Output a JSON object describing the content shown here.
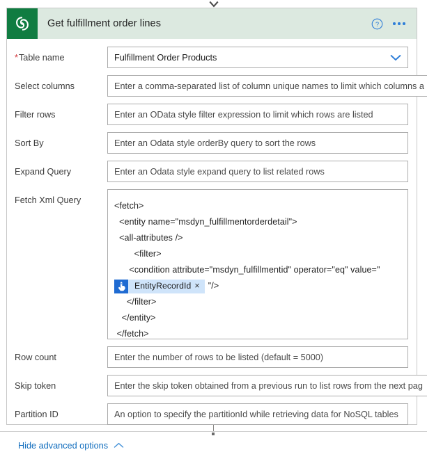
{
  "connector": {
    "arrow_icon": "arrow-down-icon",
    "stub_icon": "connector-stub"
  },
  "header": {
    "app_icon": "dataverse-icon",
    "title": "Get fulfillment order lines",
    "help_icon": "help-circle-icon",
    "more_icon": "more-horizontal-icon",
    "bg_color": "#dce9e0",
    "icon_bg_color": "#107c41",
    "accent_color": "#2f7ed8"
  },
  "fields": [
    {
      "label": "Table name",
      "required": true,
      "type": "dropdown",
      "value": "Fulfillment Order Products",
      "placeholder": "",
      "chevron_icon": "chevron-down-icon"
    },
    {
      "label": "Select columns",
      "required": false,
      "type": "text",
      "value": "",
      "placeholder": "Enter a comma-separated list of column unique names to limit which columns a"
    },
    {
      "label": "Filter rows",
      "required": false,
      "type": "text",
      "value": "",
      "placeholder": "Enter an OData style filter expression to limit which rows are listed"
    },
    {
      "label": "Sort By",
      "required": false,
      "type": "text",
      "value": "",
      "placeholder": "Enter an Odata style orderBy query to sort the rows"
    },
    {
      "label": "Expand Query",
      "required": false,
      "type": "text",
      "value": "",
      "placeholder": "Enter an Odata style expand query to list related rows"
    }
  ],
  "fetch_xml": {
    "label": "Fetch Xml Query",
    "lines_before": [
      "<fetch>",
      "  <entity name=\"msdyn_fulfillmentorderdetail\">",
      "  <all-attributes />",
      "        <filter>",
      "      <condition attribute=\"msdyn_fulfillmentid\" operator=\"eq\" value=\""
    ],
    "token": {
      "icon": "tap-hand-icon",
      "label": "EntityRecordId",
      "close_label": "×",
      "icon_bg": "#1f6bd2",
      "chip_bg": "#cfe4fa"
    },
    "token_tail": "\"/>",
    "lines_after": [
      "     </filter>",
      "   </entity>",
      " </fetch>"
    ]
  },
  "fields_bottom": [
    {
      "label": "Row count",
      "required": false,
      "type": "text",
      "value": "",
      "placeholder": "Enter the number of rows to be listed (default = 5000)"
    },
    {
      "label": "Skip token",
      "required": false,
      "type": "text",
      "value": "",
      "placeholder": "Enter the skip token obtained from a previous run to list rows from the next pag"
    },
    {
      "label": "Partition ID",
      "required": false,
      "type": "text",
      "value": "",
      "placeholder": "An option to specify the partitionId while retrieving data for NoSQL tables"
    }
  ],
  "advanced_toggle": {
    "label": "Hide advanced options",
    "chevron_icon": "chevron-up-icon",
    "link_color": "#0f6cbd"
  }
}
